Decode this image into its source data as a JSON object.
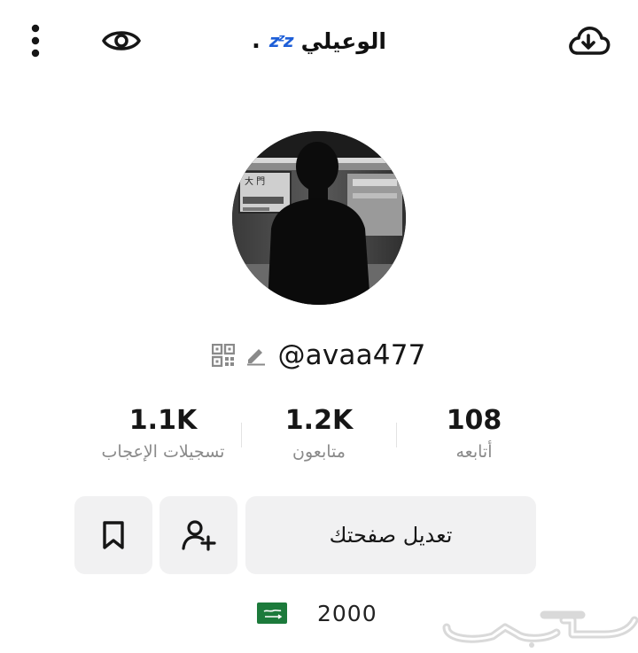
{
  "header": {
    "display_name": "الوعيلي",
    "sleep_emoji": "zᶻz",
    "dot": ".",
    "icons": [
      "more-vertical-icon",
      "eye-icon",
      "cloud-download-icon"
    ]
  },
  "profile": {
    "username": "@avaa477",
    "icons": [
      "qr-code-icon",
      "pencil-icon"
    ]
  },
  "stats": {
    "likes": {
      "value": "1.1K",
      "label": "تسجيلات الإعجاب"
    },
    "followers": {
      "value": "1.2K",
      "label": "متابعون"
    },
    "following": {
      "value": "108",
      "label": "أتابعه"
    }
  },
  "actions": {
    "edit_label": "تعديل صفحتك",
    "icons": [
      "bookmark-icon",
      "add-friend-icon"
    ]
  },
  "bio": {
    "flag": "saudi-flag-icon",
    "year": "2000"
  },
  "watermark": {
    "logo": "haraj-logo"
  },
  "colors": {
    "button_bg": "#f1f1f2",
    "muted_text": "#8a8a8a",
    "zzz_blue": "#1e5fd8",
    "flag_green": "#1c7a3b"
  }
}
